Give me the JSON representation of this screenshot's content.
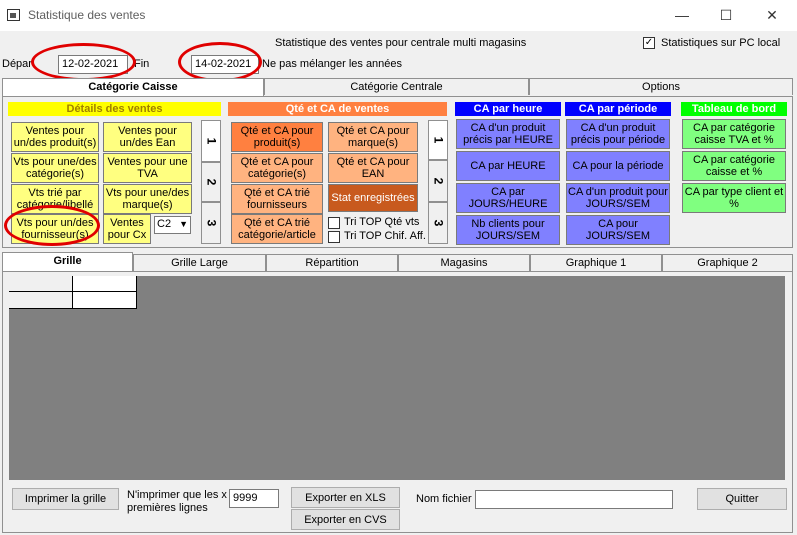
{
  "window": {
    "title": "Statistique des ventes",
    "minimize": "—",
    "maximize": "☐",
    "close": "✕"
  },
  "header": {
    "subtitle": "Statistique des ventes pour centrale multi magasins",
    "pc_label": "Statistiques sur PC local",
    "pc_checked": "✓"
  },
  "dates": {
    "depart_label": "Départ",
    "depart_value": "12-02-2021",
    "fin_label": "Fin",
    "fin_value": "14-02-2021",
    "nomix_label": "Ne pas mélanger les années"
  },
  "tabs": [
    "Catégorie Caisse",
    "Catégorie Centrale",
    "Options"
  ],
  "sections": {
    "details": "Détails des ventes",
    "qte": "Qté et CA de ventes",
    "heure": "CA par heure",
    "periode": "CA par période",
    "tableau": "Tableau de bord"
  },
  "details_buttons": [
    "Ventes pour un/des produit(s)",
    "Ventes pour un/des Ean",
    "Vts pour une/des catégorie(s)",
    "Ventes pour une TVA",
    "Vts trié par catégorie/libellé",
    "Vts pour une/des marque(s)",
    "Vts pour un/des fournisseur(s)",
    "Ventes pour Cx"
  ],
  "cx_select": "C2",
  "vtabs": [
    "1",
    "2",
    "3"
  ],
  "qte_buttons": [
    "Qté et CA pour produit(s)",
    "Qté et CA pour marque(s)",
    "Qté et CA pour catégorie(s)",
    "Qté et CA pour EAN",
    "Qté et CA trié fournisseurs",
    "Stat enregistrées",
    "Qté et CA trié catégorie/article"
  ],
  "qte_checks": [
    "Tri TOP Qté vts",
    "Tri TOP Chif. Aff."
  ],
  "heure_buttons": [
    "CA d'un produit précis par HEURE",
    "CA par HEURE",
    "CA par JOURS/HEURE",
    "Nb clients pour JOURS/SEM"
  ],
  "periode_buttons": [
    "CA d'un produit précis pour période",
    "CA pour la période",
    "CA d'un produit pour JOURS/SEM",
    "CA pour JOURS/SEM"
  ],
  "tableau_buttons": [
    "CA par catégorie caisse TVA et %",
    "CA par catégorie caisse et %",
    "CA par type client et %"
  ],
  "bottom_tabs": [
    "Grille",
    "Grille Large",
    "Répartition",
    "Magasins",
    "Graphique 1",
    "Graphique 2"
  ],
  "footer": {
    "print_grid": "Imprimer la grille",
    "print_label": "N'imprimer que les x premières lignes",
    "print_value": "9999",
    "export_xls": "Exporter en XLS",
    "export_cvs": "Exporter en CVS",
    "file_label": "Nom fichier",
    "file_value": "",
    "quit": "Quitter"
  }
}
